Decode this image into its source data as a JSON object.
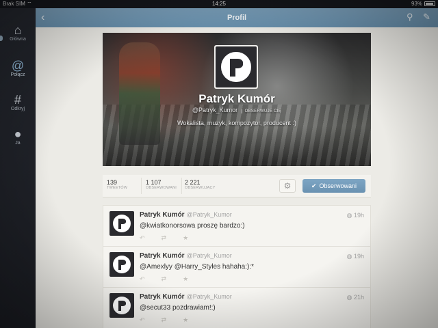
{
  "statusbar": {
    "carrier": "Brak SIM",
    "wifi_icon": "wifi-icon",
    "time": "14:25",
    "battery": "93%"
  },
  "sidebar": {
    "items": [
      {
        "label": "Główna",
        "icon": "home-icon",
        "active": false
      },
      {
        "label": "Połącz",
        "icon": "at-icon",
        "active": true
      },
      {
        "label": "Odkryj",
        "icon": "hash-icon",
        "active": false
      },
      {
        "label": "Ja",
        "icon": "person-icon",
        "active": false
      }
    ]
  },
  "topbar": {
    "title": "Profil",
    "back_icon": "chevron-left-icon",
    "search_icon": "search-icon",
    "compose_icon": "compose-icon"
  },
  "profile": {
    "name": "Patryk Kumór",
    "handle": "@Patryk_Kumor",
    "follows_you": "OBSERWUJE CIĘ",
    "bio": "Wokalista, muzyk, kompozytor, producent :)"
  },
  "stats": {
    "tweets": {
      "value": "139",
      "label": "TWEETÓW"
    },
    "following": {
      "value": "1 107",
      "label": "OBSERWOWANI"
    },
    "followers": {
      "value": "2 221",
      "label": "OBSERWUJĄCY"
    },
    "follow_button": "Obserwowani"
  },
  "tweets": [
    {
      "name": "Patryk Kumór",
      "handle": "@Patryk_Kumor",
      "time": "19h",
      "text": "@kwiatkonorsowa proszę bardzo:)"
    },
    {
      "name": "Patryk Kumór",
      "handle": "@Patryk_Kumor",
      "time": "19h",
      "text": "@Amexlyy @Harry_Styles hahaha:):*"
    },
    {
      "name": "Patryk Kumór",
      "handle": "@Patryk_Kumor",
      "time": "21h",
      "text": "@secut33 pozdrawiam!:)"
    }
  ],
  "colors": {
    "accent": "#6f96b3",
    "background": "#ecebe6",
    "sidebar": "#1f2228"
  }
}
